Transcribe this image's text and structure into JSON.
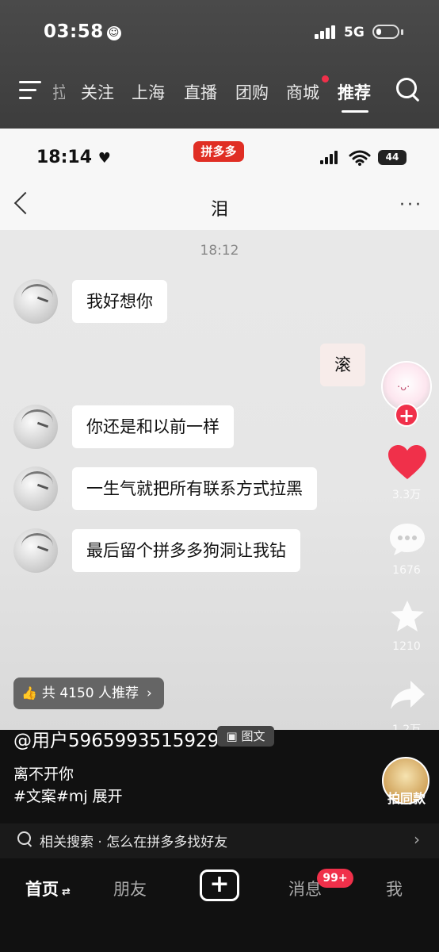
{
  "status_bar": {
    "time": "03:58",
    "network": "5G"
  },
  "top_nav": {
    "partial_tab": "拉",
    "tabs": [
      "关注",
      "上海",
      "直播",
      "团购",
      "商城",
      "推荐"
    ],
    "active": "推荐"
  },
  "inner_screenshot": {
    "time": "18:14",
    "app_badge": "拼多多",
    "battery": "44",
    "chat_title": "泪",
    "message_time": "18:12",
    "messages": [
      {
        "side": "left",
        "text": "我好想你"
      },
      {
        "side": "right",
        "text": "滚"
      },
      {
        "side": "left",
        "text": "你还是和以前一样"
      },
      {
        "side": "left",
        "text": "一生气就把所有联系方式拉黑"
      },
      {
        "side": "left",
        "text": "最后留个拼多多狗洞让我钻"
      }
    ]
  },
  "side_actions": {
    "likes": "3.3万",
    "comments": "1676",
    "favorites": "1210",
    "shares": "1.2万",
    "pai_tong_kuan": "拍同款"
  },
  "recommend_pill": "共 4150 人推荐",
  "post": {
    "author": "@用户5965993515929",
    "type_tag": "图文",
    "desc_line1": "离不开你",
    "desc_line2": "#文案#mj  展开"
  },
  "related_search": "相关搜索 · 怎么在拼多多找好友",
  "tab_bar": {
    "home": "首页",
    "friends": "朋友",
    "messages": "消息",
    "messages_badge": "99+",
    "me": "我"
  },
  "colors": {
    "accent": "#f0304a",
    "pdd_red": "#e02e24"
  }
}
